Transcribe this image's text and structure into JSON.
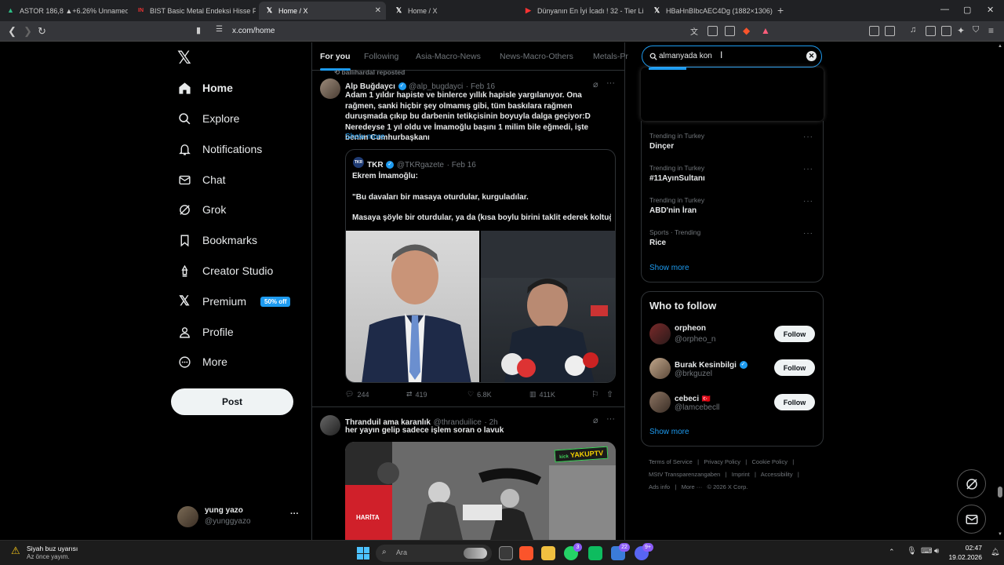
{
  "browser": {
    "tabs": [
      {
        "label": "ASTOR 186,8 ▲+6.26% Unnamed",
        "icon": "chart-icon",
        "active": false
      },
      {
        "label": "BIST Basic Metal Endeksi Hisse Fiyatla",
        "icon": "bist-icon",
        "active": false
      },
      {
        "label": "Home / X",
        "icon": "x-icon",
        "active": true
      },
      {
        "label": "Home / X",
        "icon": "x-icon",
        "active": false
      },
      {
        "label": "Dünyanın En İyi İcadı ! 32 - Tier List |",
        "icon": "youtube-icon",
        "active": false
      },
      {
        "label": "HBaHnBIbcAEC4Dg (1882×1306)",
        "icon": "x-icon",
        "active": false
      }
    ],
    "new_tab": "+",
    "url": "x.com/home",
    "window_controls": {
      "minimize": "—",
      "maximize": "▢",
      "close": "✕"
    }
  },
  "sidebar": {
    "logo": "𝕏",
    "items": [
      {
        "label": "Home",
        "icon": "home-icon"
      },
      {
        "label": "Explore",
        "icon": "search-icon"
      },
      {
        "label": "Notifications",
        "icon": "bell-icon"
      },
      {
        "label": "Chat",
        "icon": "mail-icon"
      },
      {
        "label": "Grok",
        "icon": "grok-icon"
      },
      {
        "label": "Bookmarks",
        "icon": "bookmark-icon"
      },
      {
        "label": "Creator Studio",
        "icon": "creator-icon"
      },
      {
        "label": "Premium",
        "icon": "x-icon",
        "badge": "50% off"
      },
      {
        "label": "Profile",
        "icon": "person-icon"
      },
      {
        "label": "More",
        "icon": "more-circle-icon"
      }
    ],
    "post_label": "Post",
    "account": {
      "name": "yung yazo",
      "handle": "@yunggyazo",
      "menu": "···"
    }
  },
  "feed": {
    "tabs": [
      "For you",
      "Following",
      "Asia-Macro-News",
      "News-Macro-Others",
      "Metals-Pr"
    ],
    "tweets": [
      {
        "repost_note": "ballihardal reposted",
        "author": "Alp Buğdaycı",
        "handle": "@alp_bugdayci",
        "date": "· Feb 16",
        "text": "Adam 1 yıldır hapiste ve binlerce yıllık hapisle yargılanıyor. Ona rağmen, sanki hiçbir şey olmamış gibi, tüm baskılara rağmen duruşmada çıkıp bu darbenin tetikçisinin boyuyla dalga geçiyor:D Neredeyse 1 yıl oldu ve İmamoğlu başını 1 milim bile eğmedi, işte benim Cumhurbaşkanı",
        "show_more": "Show more",
        "quote": {
          "author": "TKR",
          "avatar_text": "TKR",
          "handle": "@TKRgazete",
          "date": "· Feb 16",
          "line1": "Ekrem İmamoğlu:",
          "line2": "\"Bu davaları bir masaya oturdular, kurguladılar.",
          "line3": "Masaya şöyle bir oturdular, ya da (kısa boylu birini taklit ederek koltuğ..."
        },
        "stats": {
          "replies": "244",
          "reposts": "419",
          "likes": "6.8K",
          "views": "411K"
        }
      },
      {
        "author": "Thranduil ama karanlık",
        "handle": "@thranduilice",
        "date": "· 2h",
        "text": "her yayın gelip sadece işlem soran o lavuk",
        "media_badge": "YAKUPTV",
        "media_badge_small": "kick",
        "media_label": "HARİTA"
      }
    ]
  },
  "right": {
    "search_value": "almanyada kon",
    "trends": [
      {
        "meta": "Trending in Turkey",
        "name": "Dinçer"
      },
      {
        "meta": "Trending in Turkey",
        "name": "#11AyınSultanı"
      },
      {
        "meta": "Trending in Turkey",
        "name": "ABD'nin İran"
      },
      {
        "meta": "Sports · Trending",
        "name": "Rice"
      }
    ],
    "trends_show_more": "Show more",
    "who_to_follow_title": "Who to follow",
    "follow_label": "Follow",
    "suggestions": [
      {
        "name": "orpheon",
        "handle": "@orpheo_n",
        "verified": false,
        "flag": ""
      },
      {
        "name": "Burak Kesinbilgi",
        "handle": "@brkguzel",
        "verified": true,
        "flag": ""
      },
      {
        "name": "cebeci",
        "handle": "@lamcebecll",
        "verified": false,
        "flag": "🇹🇷"
      }
    ],
    "follow_show_more": "Show more",
    "footer": {
      "line1": [
        "Terms of Service",
        "|",
        "Privacy Policy",
        "|",
        "Cookie Policy",
        "|"
      ],
      "line2": [
        "MStV Transparenzangaben",
        "|",
        "Imprint",
        "|",
        "Accessibility",
        "|"
      ],
      "line3": [
        "Ads info",
        "|",
        "More ···",
        "© 2026 X Corp."
      ]
    }
  },
  "taskbar": {
    "weather_title": "Siyah buz uyarısı",
    "weather_sub": "Az önce yayım.",
    "search_placeholder": "Ara",
    "time": "02:47",
    "date": "19.02.2026",
    "badges": {
      "whatsapp": "3",
      "edge": "22",
      "discord": "9+"
    }
  },
  "colors": {
    "accent": "#1d9bf0",
    "bg": "#000000",
    "text": "#e7e9ea",
    "muted": "#71767b",
    "border": "#2f3336"
  }
}
